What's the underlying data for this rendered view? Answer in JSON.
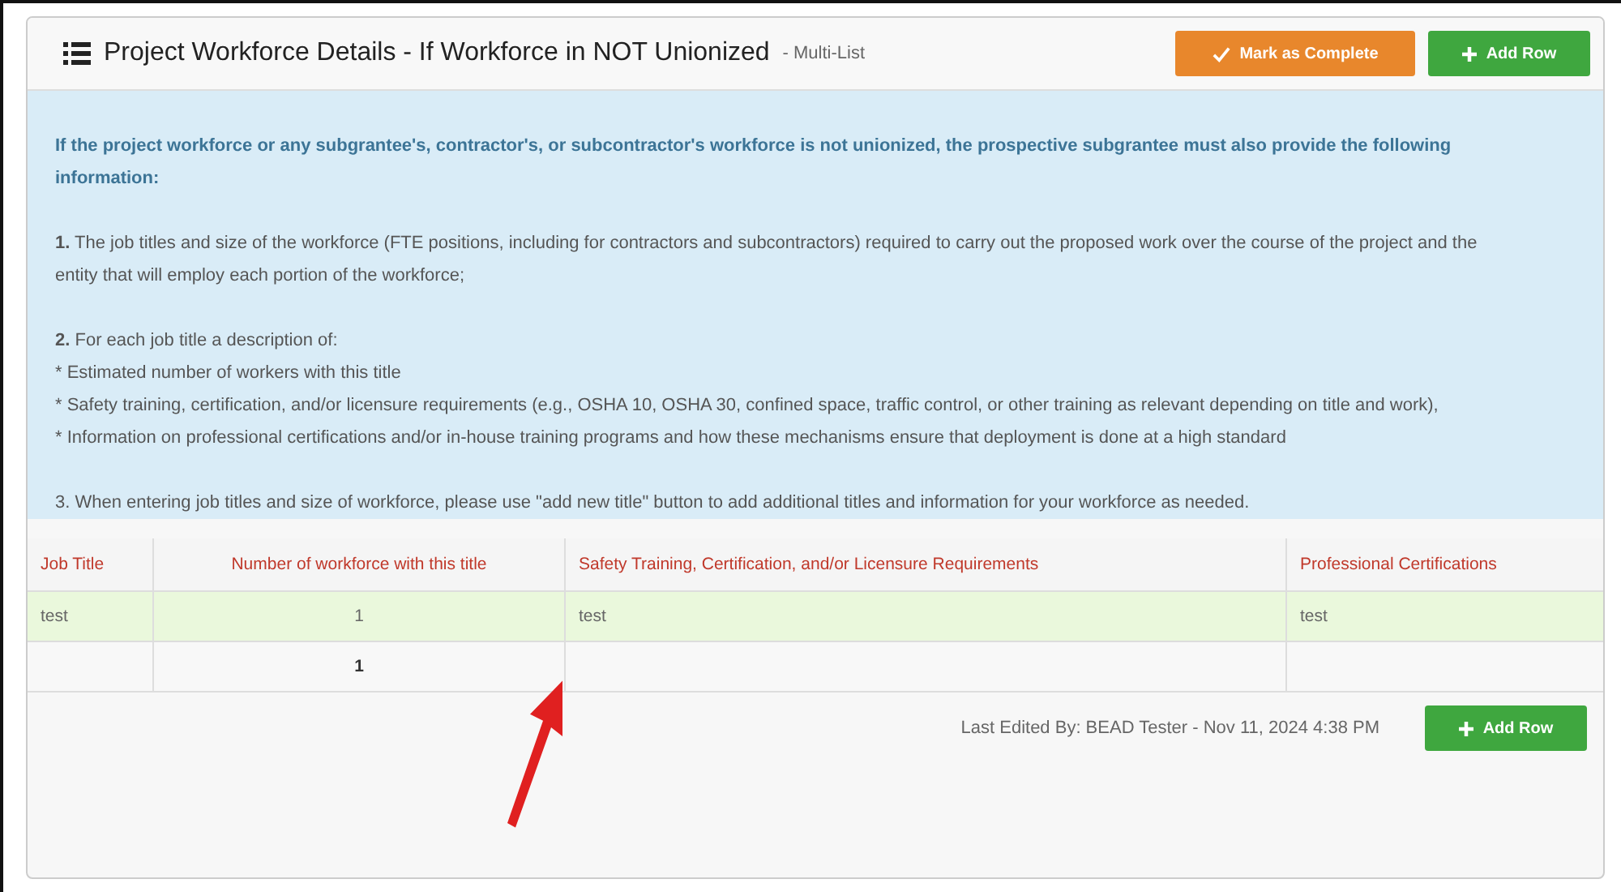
{
  "panel": {
    "title": "Project Workforce Details - If Workforce in NOT Unionized",
    "subtitle": "- Multi-List",
    "buttons": [
      {
        "kind": "complete",
        "label": "Mark as Complete"
      },
      {
        "kind": "add",
        "label": "Add Row"
      }
    ]
  },
  "instructions": {
    "intro": "If the project workforce or any subgrantee's, contractor's, or subcontractor's workforce is not unionized, the prospective subgrantee must also provide the following information:",
    "blocks": [
      [
        "**1.** The job titles and size of the workforce (FTE positions, including for contractors and subcontractors) required to carry out the proposed work over the course of the project and the entity that will employ each portion of the workforce;"
      ],
      [
        "**2.** For each job title a description of:",
        "* Estimated number of workers with this title",
        "* Safety training, certification, and/or licensure requirements (e.g., OSHA 10, OSHA 30, confined space, traffic control, or other training as relevant depending on title and work),",
        "* Information on professional certifications and/or in-house training programs and how these mechanisms ensure that deployment is done at a high standard"
      ],
      [
        "3. When entering job titles and size of workforce, please use \"add new title\" button to add additional titles and information for your workforce as needed."
      ]
    ]
  },
  "table": {
    "columns": [
      "Job Title",
      "Number of workforce with this title",
      "Safety Training, Certification, and/or Licensure Requirements",
      "Professional Certifications"
    ],
    "rows": [
      {
        "kind": "data",
        "highlighted": true,
        "cells": [
          "test",
          "1",
          "test",
          "test"
        ]
      },
      {
        "kind": "total",
        "highlighted": false,
        "cells": [
          "",
          "1",
          "",
          ""
        ]
      }
    ]
  },
  "footer": {
    "last_edited": "Last Edited By: BEAD Tester - Nov 11, 2024 4:38 PM",
    "button": {
      "kind": "add",
      "label": "Add Row"
    }
  },
  "annotation": {
    "kind": "arrow"
  }
}
